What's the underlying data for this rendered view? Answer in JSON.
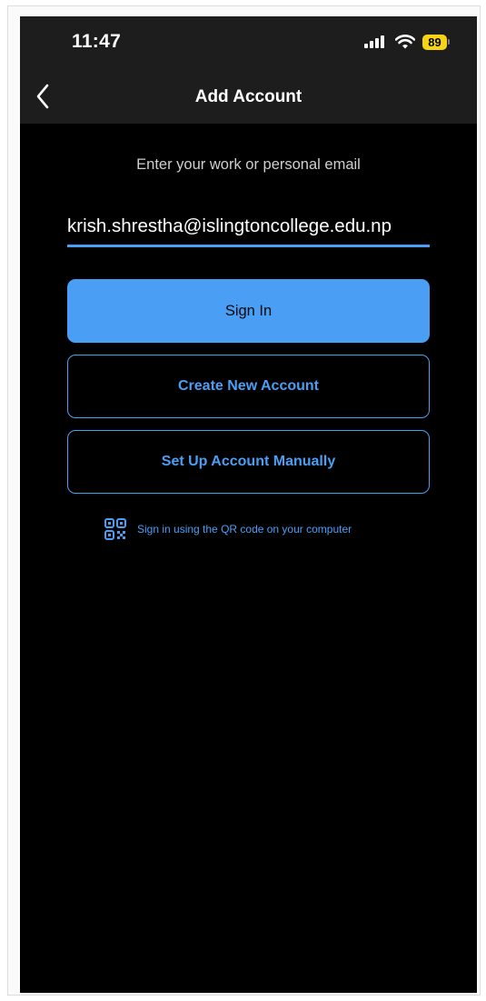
{
  "status_bar": {
    "time": "11:47",
    "battery": "89",
    "battery_color": "#f5d416"
  },
  "nav": {
    "back_icon": "chevron-left-icon",
    "title": "Add Account"
  },
  "form": {
    "prompt": "Enter your work or personal email",
    "email_value": "krish.shrestha@islingtoncollege.edu.np"
  },
  "buttons": {
    "sign_in": "Sign In",
    "create_account": "Create New Account",
    "manual_setup": "Set Up Account Manually"
  },
  "qr": {
    "icon": "qr-code-icon",
    "label": "Sign in using the QR code on your computer"
  },
  "colors": {
    "accent": "#4a9ff5",
    "background": "#000000",
    "header": "#1d1d1d"
  }
}
